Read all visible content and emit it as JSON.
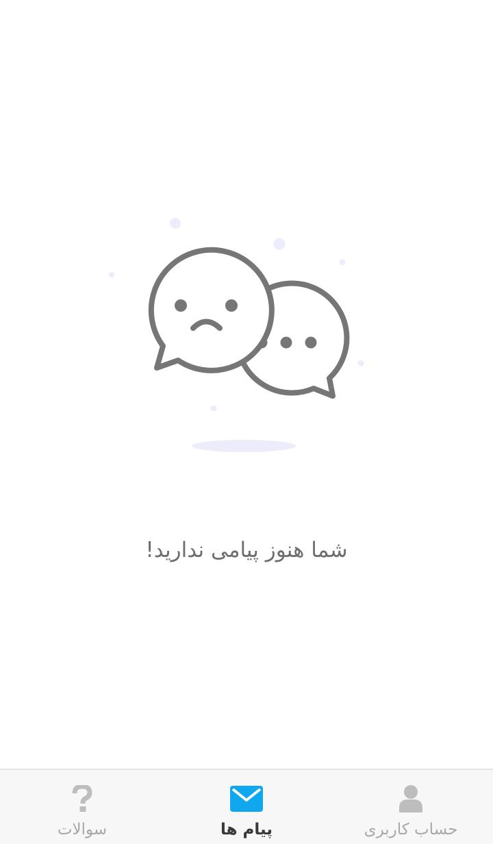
{
  "empty_state": {
    "message": "شما هنوز پیامی ندارید!",
    "illustration_icon": "chat-bubbles-sad-icon",
    "stroke_color": "#767676",
    "dot_color": "#ececfb"
  },
  "bottom_nav": {
    "active_color": "#10a7ef",
    "inactive_color": "#bdbdbd",
    "items": [
      {
        "label": "سوالات",
        "icon": "question-icon",
        "active": false
      },
      {
        "label": "پیام ها",
        "icon": "envelope-icon",
        "active": true
      },
      {
        "label": "حساب کاربری",
        "icon": "user-icon",
        "active": false
      }
    ]
  }
}
